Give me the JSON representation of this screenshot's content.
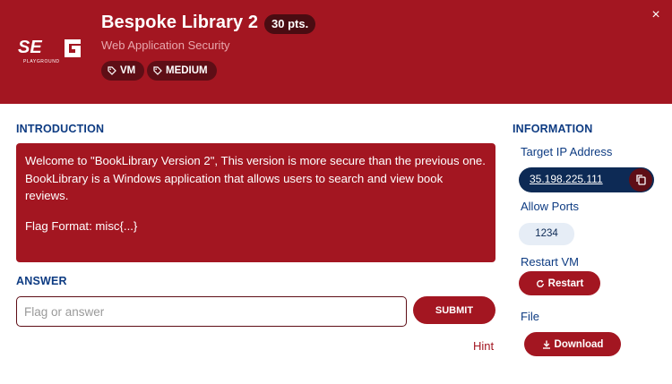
{
  "header": {
    "logo_text": "SEC",
    "logo_subtext": "PLAYGROUND",
    "title": "Bespoke Library 2",
    "points": "30 pts.",
    "subtitle": "Web Application Security",
    "tags": [
      "VM",
      "MEDIUM"
    ],
    "close_label": "×"
  },
  "introduction": {
    "heading": "INTRODUCTION",
    "line1": "Welcome to \"BookLibrary Version 2\", This version is more secure than the previous one.",
    "line2": "BookLibrary is a Windows application that allows users to search and view book reviews.",
    "line3": "Flag Format: misc{...}"
  },
  "answer": {
    "heading": "ANSWER",
    "placeholder": "Flag or answer",
    "submit_label": "SUBMIT",
    "hint_label": "Hint"
  },
  "information": {
    "heading": "INFORMATION",
    "target_ip_label": "Target IP Address",
    "target_ip": "35.198.225.111",
    "allow_ports_label": "Allow Ports",
    "ports": "1234",
    "restart_vm_label": "Restart VM",
    "restart_button": "Restart",
    "file_label": "File",
    "download_button": "Download"
  },
  "colors": {
    "primary": "#a31621",
    "dark_red": "#5e0e16",
    "navy": "#0d2a55",
    "heading_blue": "#0d3b82"
  }
}
